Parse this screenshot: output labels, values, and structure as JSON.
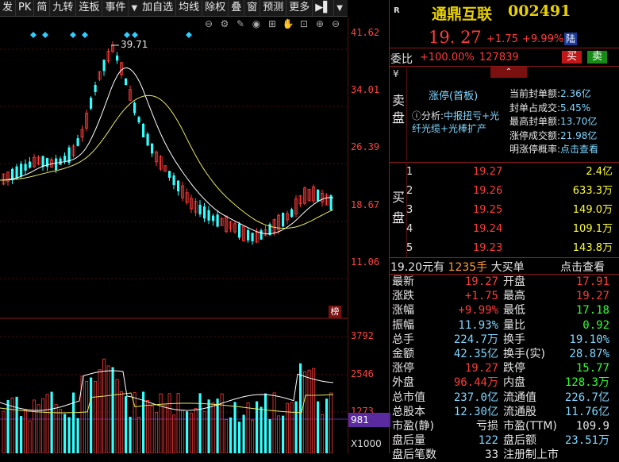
{
  "toolbar": {
    "items": [
      "发",
      "PK",
      "简",
      "九转",
      "连板",
      "事件",
      "加自选",
      "均线",
      "除权",
      "叠",
      "窗",
      "预测",
      "更多"
    ],
    "arrow": "▼",
    "flag_glyph": "▶▌"
  },
  "iconbar": [
    "⊖",
    "⚙",
    "✎",
    "◉",
    "⊞",
    "✋",
    "⊡",
    "⊕",
    "⊖"
  ],
  "kchart": {
    "price_labels": [
      "41.62",
      "34.01",
      "26.39",
      "18.67",
      "11.06"
    ],
    "peak_label": "39.71",
    "badge": "榜"
  },
  "volchart": {
    "labels": [
      "3792",
      "2546",
      "1273"
    ],
    "current": "981",
    "unit": "X1000"
  },
  "header": {
    "r_mark": "R",
    "name": "通鼎互联",
    "code": "002491",
    "price": "19. 27",
    "change": "+1.75",
    "pct": "+9.99%",
    "tag": "陆"
  },
  "weibi": {
    "label": "委比",
    "pct": "+100.00%",
    "value": "127839",
    "buy": "买",
    "sell": "卖"
  },
  "sell_side": {
    "yen": "¥",
    "label": "卖盘",
    "title": "涨停(首板)",
    "analysis_label": "ⓘ分析:",
    "analysis_text": "中报扭亏+光纤光缆+光棒扩产",
    "stats": [
      {
        "k": "当前封单额:",
        "v": "2.36亿"
      },
      {
        "k": "封单占成交:",
        "v": "5.45%"
      },
      {
        "k": "最高封单额:",
        "v": "13.70亿"
      },
      {
        "k": "涨停成交额:",
        "v": "21.98亿"
      },
      {
        "k": "明涨停概率:",
        "v": "点击查看"
      }
    ]
  },
  "buy_side": {
    "label": "买盘",
    "rows": [
      {
        "i": "1",
        "p": "19.27",
        "q": "2.4亿"
      },
      {
        "i": "2",
        "p": "19.26",
        "q": "633.3万"
      },
      {
        "i": "3",
        "p": "19.25",
        "q": "149.0万"
      },
      {
        "i": "4",
        "p": "19.24",
        "q": "109.1万"
      },
      {
        "i": "5",
        "p": "19.23",
        "q": "143.8万"
      }
    ]
  },
  "big_order": {
    "price": "19.20元有",
    "hands": "1235手",
    "label": "大买单",
    "link": "点击查看"
  },
  "quote": [
    {
      "k1": "最新",
      "v1": "19.27",
      "c1": "red",
      "k2": "开盘",
      "v2": "17.91",
      "c2": "red"
    },
    {
      "k1": "涨跌",
      "v1": "+1.75",
      "c1": "red",
      "k2": "最高",
      "v2": "19.27",
      "c2": "red"
    },
    {
      "k1": "涨幅",
      "v1": "+9.99%",
      "c1": "red",
      "k2": "最低",
      "v2": "17.18",
      "c2": "green"
    },
    {
      "k1": "振幅",
      "v1": "11.93%",
      "c1": "cyan",
      "k2": "量比",
      "v2": "0.92",
      "c2": "green"
    },
    {
      "k1": "总手",
      "v1": "224.7万",
      "c1": "cyan",
      "k2": "换手",
      "v2": "19.10%",
      "c2": "cyan"
    },
    {
      "k1": "金额",
      "v1": "42.35亿",
      "c1": "cyan",
      "k2": "换手(实)",
      "v2": "28.87%",
      "c2": "cyan"
    },
    {
      "k1": "涨停",
      "v1": "19.27",
      "c1": "red",
      "k2": "跌停",
      "v2": "15.77",
      "c2": "green"
    },
    {
      "k1": "外盘",
      "v1": "96.44万",
      "c1": "red",
      "k2": "内盘",
      "v2": "128.3万",
      "c2": "green"
    },
    {
      "k1": "总市值",
      "v1": "237.0亿",
      "c1": "cyan",
      "k2": "流通值",
      "v2": "226.7亿",
      "c2": "cyan"
    },
    {
      "k1": "总股本",
      "v1": "12.30亿",
      "c1": "cyan",
      "k2": "流通股",
      "v2": "11.76亿",
      "c2": "cyan"
    },
    {
      "k1": "市盈(静)",
      "v1": "亏损",
      "c1": "white",
      "k2": "市盈(TTM)",
      "v2": "109.9",
      "c2": "white"
    },
    {
      "k1": "盘后量",
      "v1": "122",
      "c1": "cyan",
      "k2": "盘后额",
      "v2": "23.51万",
      "c2": "cyan"
    },
    {
      "k1": "盘后笔数",
      "v1": "33",
      "c1": "white",
      "k2": "注册制上市",
      "v2": "",
      "c2": "white"
    }
  ],
  "colors": {
    "up": "#ff3b3b",
    "down": "#33ffff",
    "ma1": "#ffffff",
    "ma2": "#e8e860",
    "accent_line": "#8b1a1a"
  }
}
